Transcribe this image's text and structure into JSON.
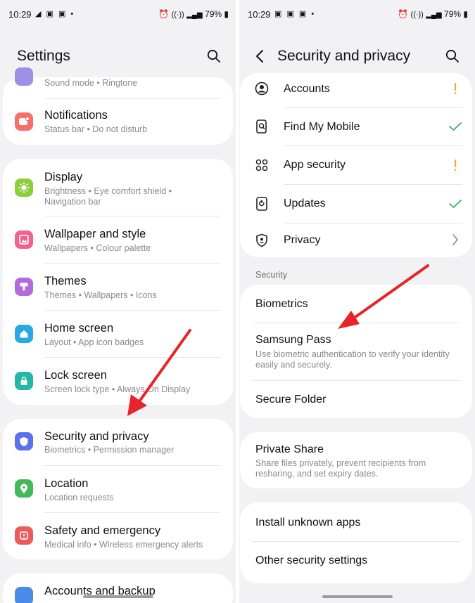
{
  "left": {
    "status": {
      "time": "10:29",
      "left_icons": "◢ ▣ ▣ •",
      "network": "VoLTE LTE1",
      "battery": "79%"
    },
    "header": {
      "title": "Settings",
      "search_icon": "search-icon"
    },
    "items": {
      "sound_sub": "Sound mode  •  Ringtone",
      "notifications": {
        "title": "Notifications",
        "sub": "Status bar  •  Do not disturb",
        "color": "#f4706a"
      },
      "display": {
        "title": "Display",
        "sub1": "Brightness  •  Eye comfort shield  •",
        "sub2": "Navigation bar",
        "color": "#8bcf3d"
      },
      "wallpaper": {
        "title": "Wallpaper and style",
        "sub": "Wallpapers  •  Colour palette",
        "color": "#f06292"
      },
      "themes": {
        "title": "Themes",
        "sub": "Themes  •  Wallpapers  •  Icons",
        "color": "#b36bdc"
      },
      "home": {
        "title": "Home screen",
        "sub": "Layout  •  App icon badges",
        "color": "#29a9e1"
      },
      "lock": {
        "title": "Lock screen",
        "sub": "Screen lock type  •  Always On Display",
        "color": "#22b8a6"
      },
      "security": {
        "title": "Security and privacy",
        "sub": "Biometrics  •  Permission manager",
        "color": "#5b72e8"
      },
      "location": {
        "title": "Location",
        "sub": "Location requests",
        "color": "#43b85c"
      },
      "safety": {
        "title": "Safety and emergency",
        "sub": "Medical info  •  Wireless emergency alerts",
        "color": "#ea5b5b"
      },
      "accounts": {
        "title": "Accounts and backup",
        "color": "#4a8be8"
      }
    }
  },
  "right": {
    "status": {
      "time": "10:29",
      "left_icons": "▣ ▣ ▣ •",
      "network": "VoLTE LTE1",
      "battery": "79%"
    },
    "header": {
      "title": "Security and privacy",
      "back_icon": "back-arrow-icon",
      "search_icon": "search-icon"
    },
    "top_items": [
      {
        "title": "Accounts",
        "status": "warning"
      },
      {
        "title": "Find My Mobile",
        "status": "ok"
      },
      {
        "title": "App security",
        "status": "warning"
      },
      {
        "title": "Updates",
        "status": "ok"
      },
      {
        "title": "Privacy",
        "status": "chevron"
      }
    ],
    "section_label": "Security",
    "security_items": {
      "biometrics": "Biometrics",
      "samsung_pass": {
        "title": "Samsung Pass",
        "sub": "Use biometric authentication to verify your identity easily and securely."
      },
      "secure_folder": "Secure Folder"
    },
    "private_share": {
      "title": "Private Share",
      "sub": "Share files privately, prevent recipients from resharing, and set expiry dates."
    },
    "other_items": {
      "install_unknown": "Install unknown apps",
      "other_security": "Other security settings"
    },
    "colors": {
      "warning": "#f2a531",
      "ok": "#3fae5e"
    }
  },
  "annotation": {
    "arrow_color": "#e8232a"
  }
}
